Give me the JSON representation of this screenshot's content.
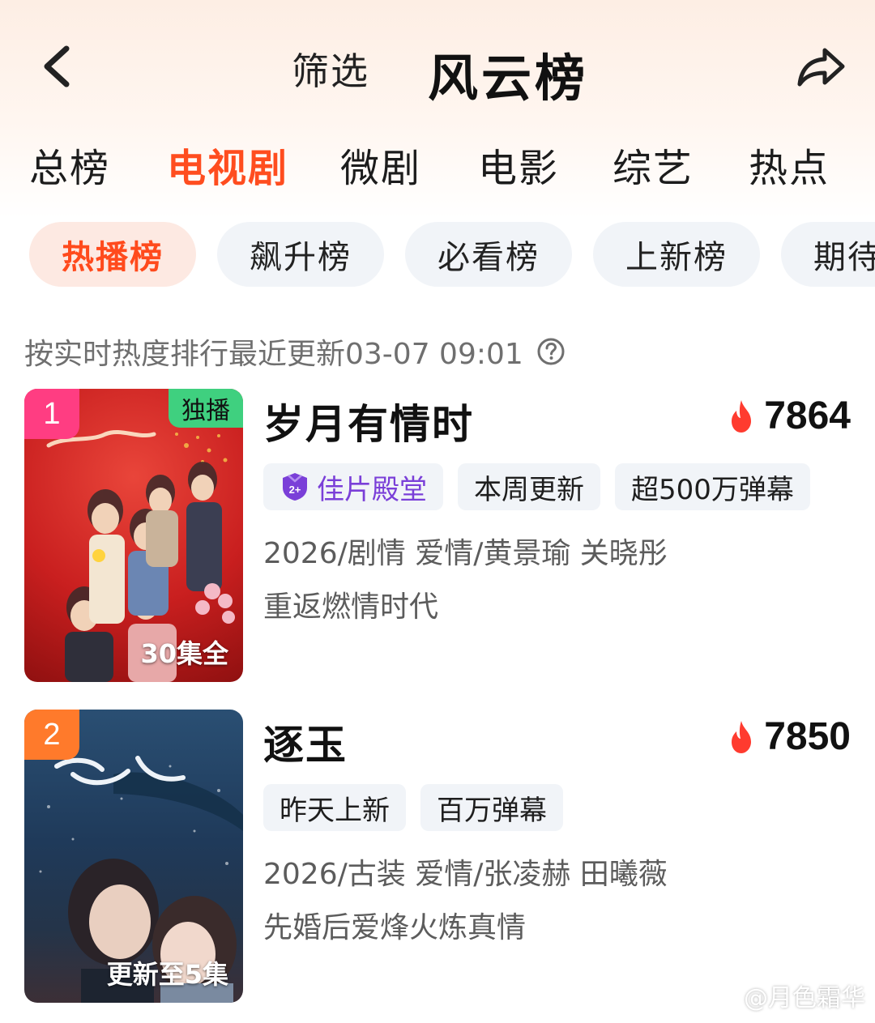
{
  "header": {
    "filter_label": "筛选",
    "title": "风云榜",
    "back_icon": "back-arrow-icon",
    "share_icon": "share-icon"
  },
  "category_tabs": [
    {
      "label": "总榜",
      "active": false
    },
    {
      "label": "电视剧",
      "active": true
    },
    {
      "label": "微剧",
      "active": false
    },
    {
      "label": "电影",
      "active": false
    },
    {
      "label": "综艺",
      "active": false
    },
    {
      "label": "热点",
      "active": false
    }
  ],
  "sub_tabs": [
    {
      "label": "热播榜",
      "active": true
    },
    {
      "label": "飙升榜",
      "active": false
    },
    {
      "label": "必看榜",
      "active": false
    },
    {
      "label": "上新榜",
      "active": false
    },
    {
      "label": "期待",
      "active": false
    }
  ],
  "rank_note": "按实时热度排行最近更新03-07 09:01",
  "colors": {
    "accent": "#ff4d1f",
    "rank1": "#ff3d82",
    "rank2": "#ff7a2b",
    "exclusive": "#3fd07f",
    "hall": "#7a3fd8"
  },
  "items": [
    {
      "rank": "1",
      "title": "岁月有情时",
      "heat": "7864",
      "exclusive_badge": "独播",
      "episode_label": "30集全",
      "hall_tag": "佳片殿堂",
      "tags": [
        "本周更新",
        "超500万弹幕"
      ],
      "meta": "2026/剧情 爱情/黄景瑜 关晓彤",
      "slogan": "重返燃情时代"
    },
    {
      "rank": "2",
      "title": "逐玉",
      "heat": "7850",
      "episode_label": "更新至5集",
      "tags": [
        "昨天上新",
        "百万弹幕"
      ],
      "meta": "2026/古装 爱情/张凌赫 田曦薇",
      "slogan": "先婚后爱烽火炼真情"
    }
  ],
  "watermark": "@月色霜华"
}
